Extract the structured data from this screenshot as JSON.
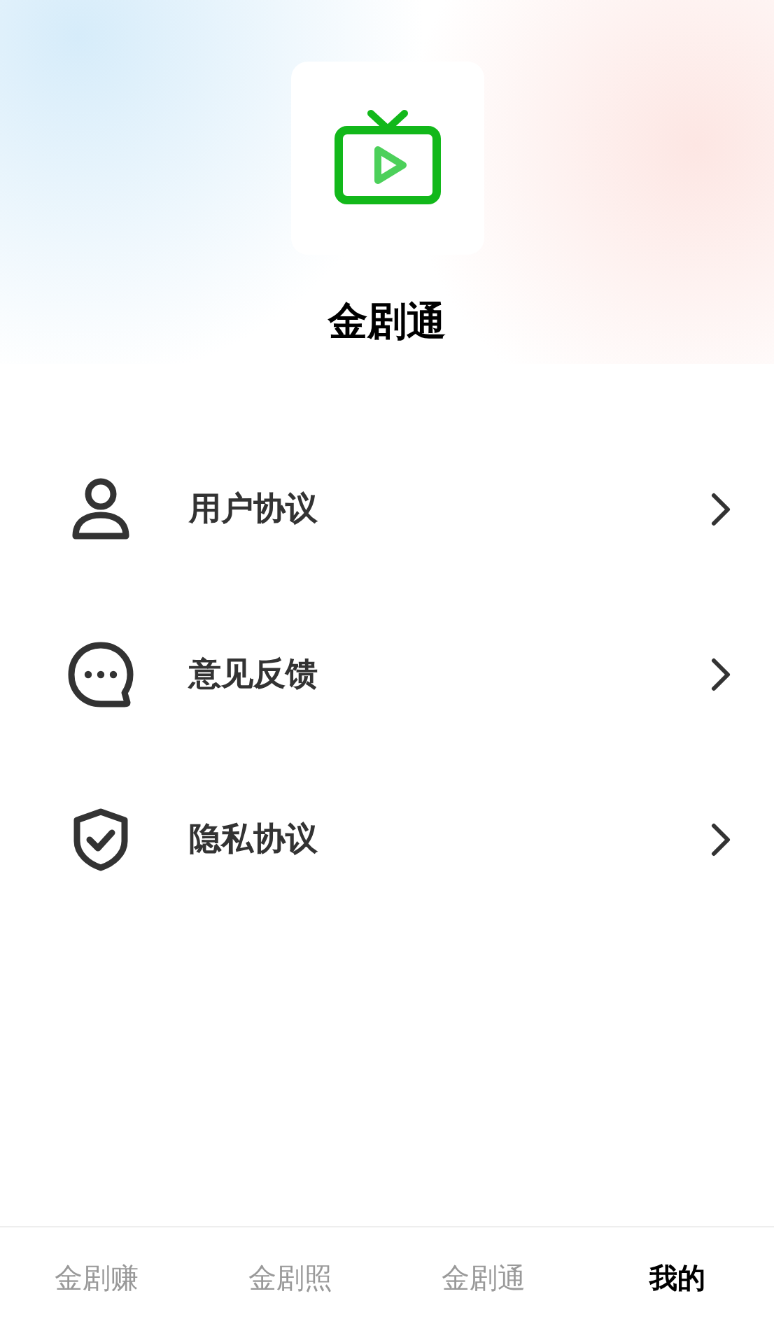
{
  "app": {
    "name": "金剧通"
  },
  "menu": [
    {
      "kind": "person",
      "label": "用户协议"
    },
    {
      "kind": "chat",
      "label": "意见反馈"
    },
    {
      "kind": "shield",
      "label": "隐私协议"
    }
  ],
  "tabs": [
    {
      "label": "金剧赚",
      "selected": false
    },
    {
      "label": "金剧照",
      "selected": false
    },
    {
      "label": "金剧通",
      "selected": false
    },
    {
      "label": "我的",
      "selected": true
    }
  ]
}
